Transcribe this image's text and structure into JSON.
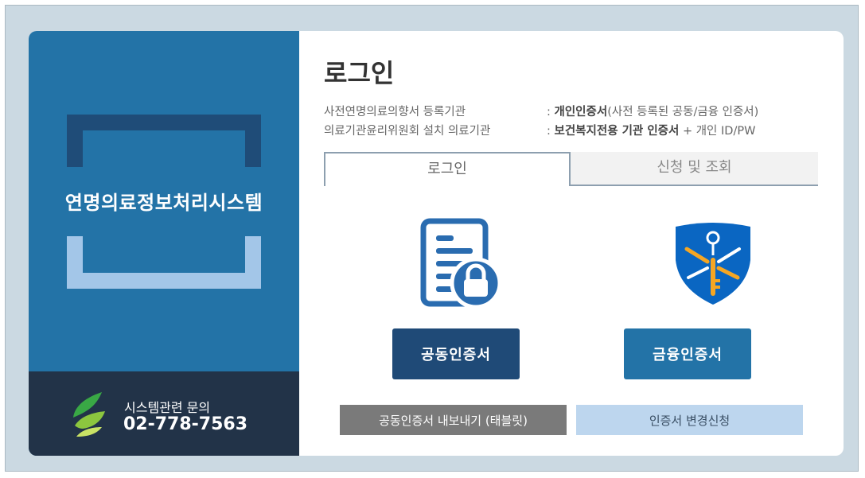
{
  "sidebar": {
    "system_title": "연명의료정보처리시스템",
    "contact_label": "시스템관련 문의",
    "contact_phone": "02-778-7563"
  },
  "main": {
    "title": "로그인",
    "info": [
      {
        "label": "사전연명의료의향서 등록기관",
        "bold": "개인인증서",
        "rest": "(사전 등록된 공동/금융 인증서)"
      },
      {
        "label": "의료기관윤리위원회 설치 의료기관",
        "bold": "보건복지전용 기관 인증서",
        "rest": " + 개인 ID/PW"
      }
    ],
    "tabs": [
      {
        "label": "로그인",
        "active": true
      },
      {
        "label": "신청 및 조회",
        "active": false
      }
    ],
    "icons": {
      "public_cert": "document-lock-icon",
      "finance_cert": "key-shield-icon"
    },
    "buttons": {
      "public_cert": "공동인증서",
      "finance_cert": "금융인증서"
    },
    "sub_buttons": {
      "export": "공동인증서 내보내기 (태블릿)",
      "change": "인증서 변경신청"
    }
  },
  "colors": {
    "sidebar": "#2373a7",
    "sidebar_footer": "#223348",
    "bracket_dark": "#1f4c78",
    "bracket_light": "#a3c6e8",
    "button_dark": "#1f4a77",
    "button_blue": "#2373a7",
    "shield_orange": "#f5a623"
  }
}
